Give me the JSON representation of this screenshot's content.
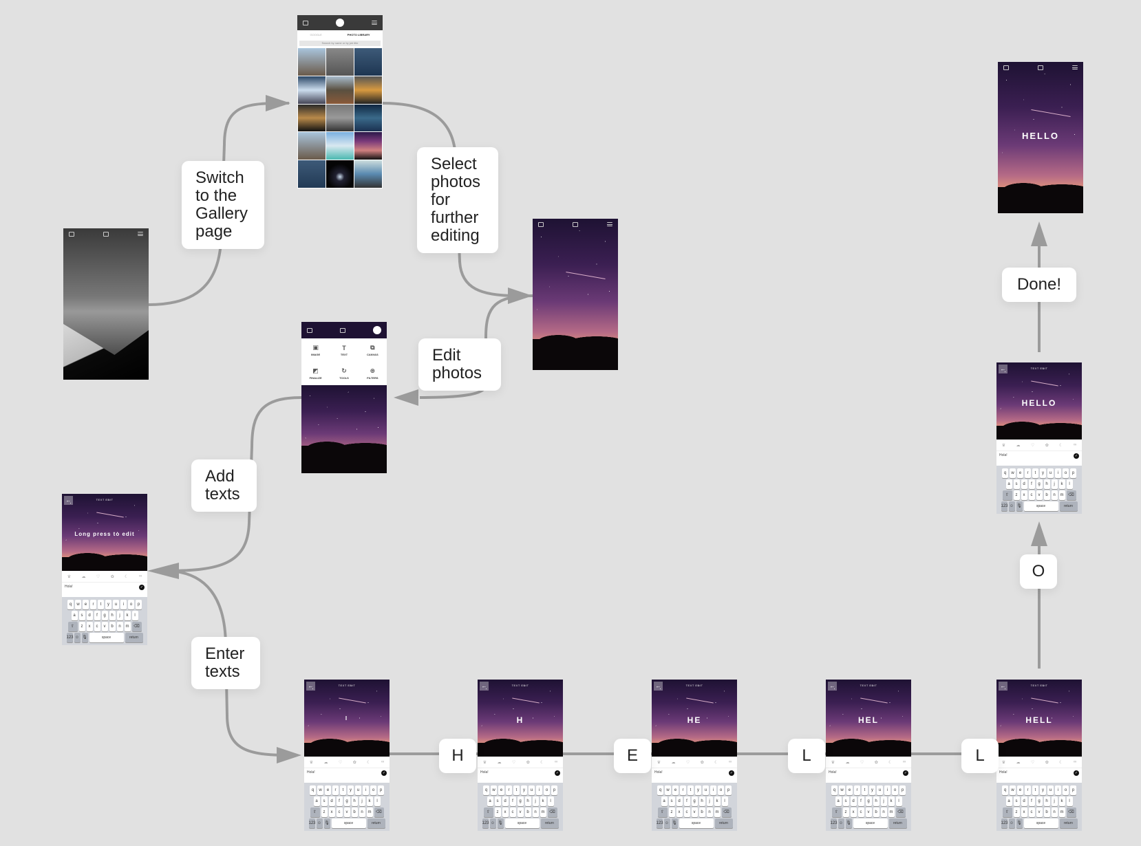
{
  "colors": {
    "background": "#e1e1e1",
    "arrow": "#9b9b9b",
    "label_bg": "#ffffff",
    "label_text": "#222222"
  },
  "labels": {
    "switch_gallery": "Switch to the Gallery page",
    "select_photos": "Select photos for further editing",
    "edit_photos": "Edit photos",
    "add_texts": "Add texts",
    "enter_texts": "Enter texts",
    "key_h": "H",
    "key_e": "E",
    "key_l1": "L",
    "key_l2": "L",
    "key_o": "O",
    "done": "Done!"
  },
  "screens": {
    "home": {
      "icons": [
        "share-icon",
        "gallery-icon",
        "menu-icon"
      ]
    },
    "gallery": {
      "tabs": [
        "GOOGLE",
        "PHOTO LIBRARY"
      ],
      "search_placeholder": "Search by name or by job title"
    },
    "selected_photo": {
      "icons": [
        "share-icon",
        "gallery-icon",
        "menu-icon"
      ]
    },
    "menu": {
      "items": [
        {
          "label": "IMAGE",
          "icon": "image-icon",
          "glyph": "▣"
        },
        {
          "label": "TEXT",
          "icon": "text-icon",
          "glyph": "T"
        },
        {
          "label": "CANVAS",
          "icon": "canvas-icon",
          "glyph": "⧉"
        },
        {
          "label": "FINALIZE",
          "icon": "finalize-icon",
          "glyph": "◩"
        },
        {
          "label": "TOOLS",
          "icon": "tools-icon",
          "glyph": "↻"
        },
        {
          "label": "FILTERS",
          "icon": "filters-icon",
          "glyph": "⊛"
        }
      ]
    },
    "text_edit": {
      "title": "TEXT EDIT",
      "back": "←",
      "placeholder_text": "Long press to edit",
      "input_value": "Hola!",
      "check": "✓",
      "tool_glyphs": [
        "♛",
        "☁",
        "♡",
        "✿",
        "☾",
        "∞"
      ],
      "keyboard": {
        "row1": [
          "q",
          "w",
          "e",
          "r",
          "t",
          "y",
          "u",
          "i",
          "o",
          "p"
        ],
        "row2": [
          "a",
          "s",
          "d",
          "f",
          "g",
          "h",
          "j",
          "k",
          "l"
        ],
        "row3": [
          "⇧",
          "z",
          "x",
          "c",
          "v",
          "b",
          "n",
          "m",
          "⌫"
        ],
        "row4": [
          "123",
          "☺",
          "🎙",
          "space",
          "return"
        ]
      }
    },
    "typing_sequence": [
      "I",
      "H",
      "HE",
      "HEL",
      "HELL",
      "HELLO"
    ],
    "final": {
      "text": "HELLO"
    }
  }
}
